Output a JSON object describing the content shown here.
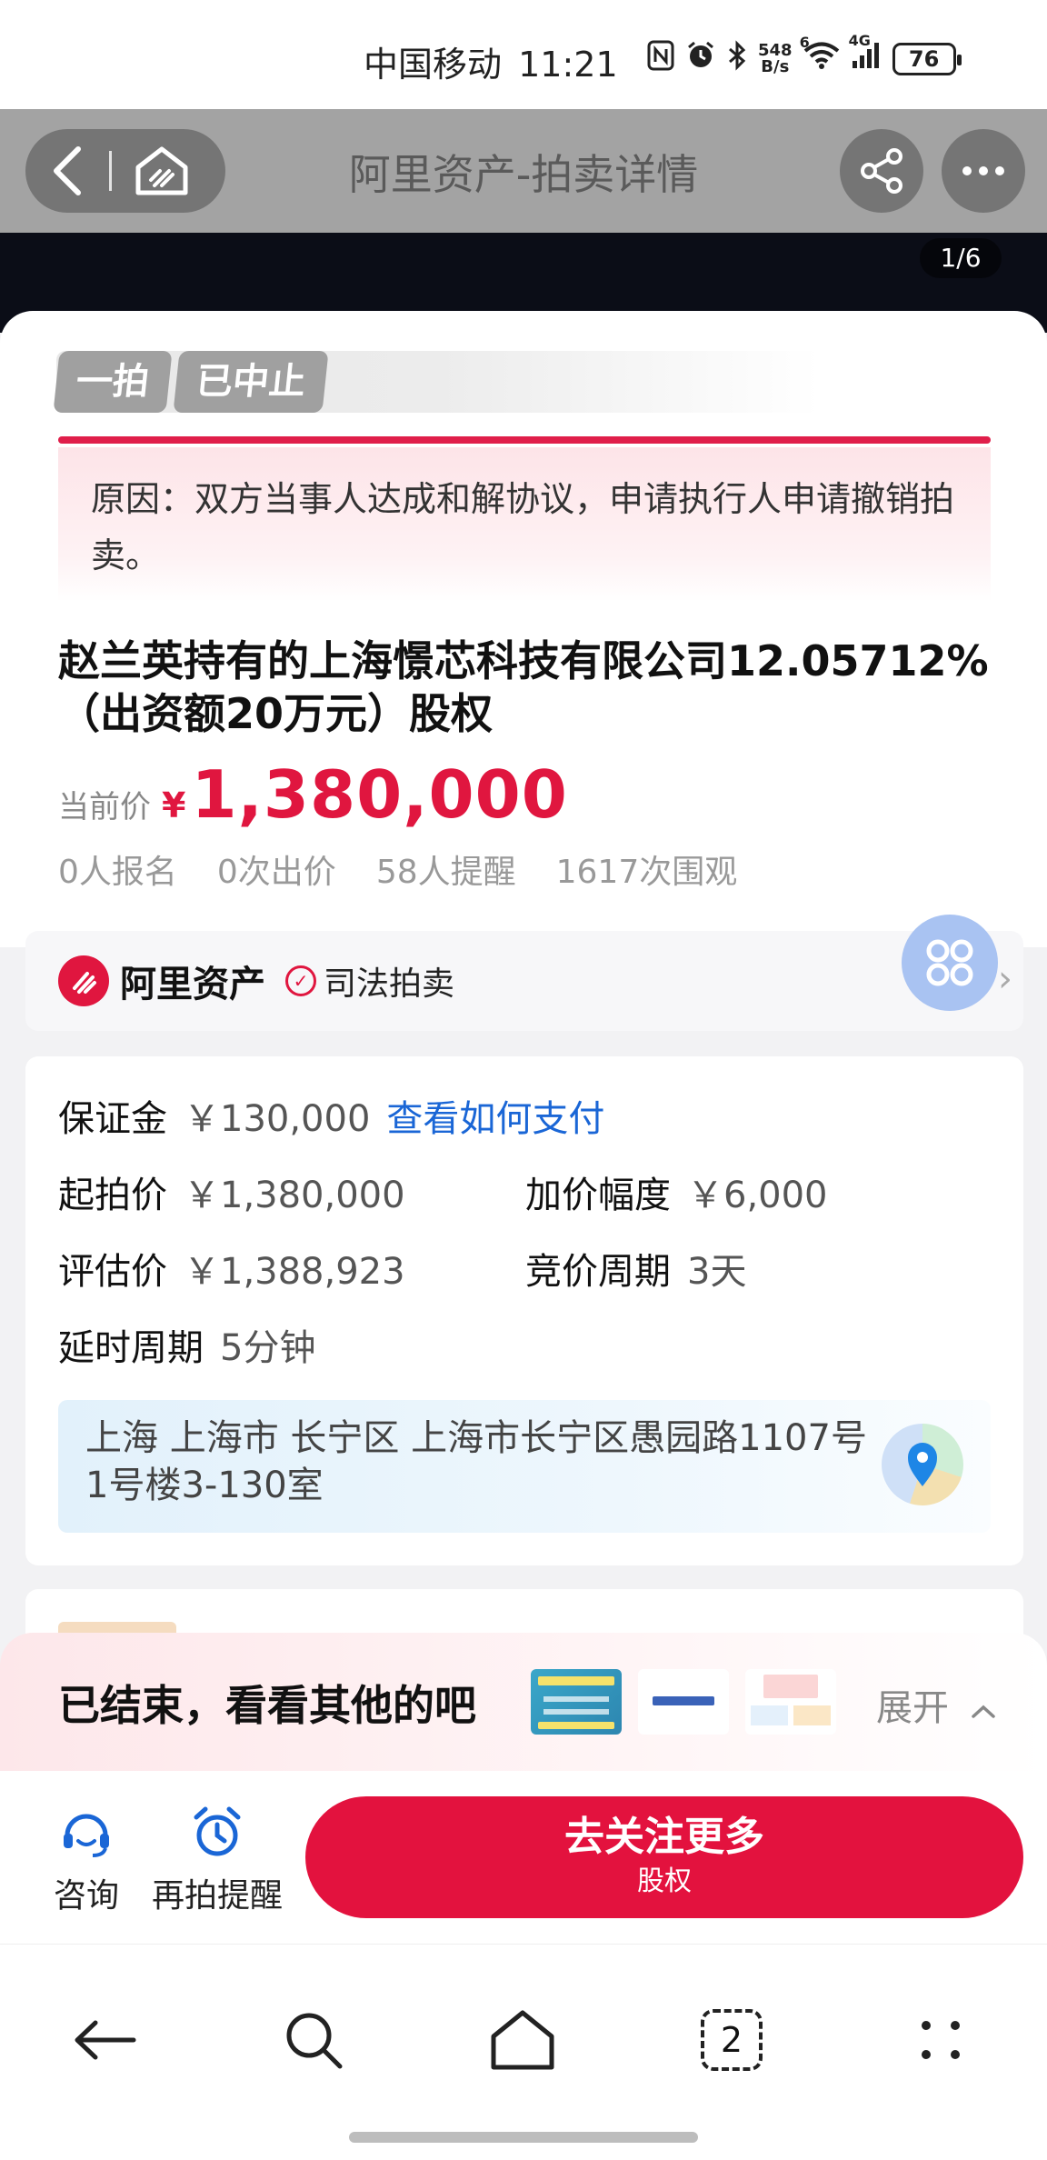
{
  "status_bar": {
    "carrier": "中国移动",
    "time": "11:21",
    "net_speed_value": "548",
    "net_speed_unit": "B/s",
    "signal_6": "6",
    "signal_4g": "4G",
    "battery": "76"
  },
  "nav": {
    "title": "阿里资产-拍卖详情",
    "icons": [
      "back-icon",
      "home-icon",
      "share-icon",
      "more-icon"
    ]
  },
  "gallery": {
    "counter": "1/6"
  },
  "auction": {
    "round_tag": "一拍",
    "status_tag": "已中止",
    "reason": "原因：双方当事人达成和解协议，申请执行人申请撤销拍卖。",
    "title": "赵兰英持有的上海憬芯科技有限公司12.05712%（出资额20万元）股权",
    "price_label": "当前价",
    "currency": "¥",
    "current_price": "1,380,000",
    "stats": {
      "signups": "0人报名",
      "bids": "0次出价",
      "reminders": "58人提醒",
      "views": "1617次围观"
    }
  },
  "platform": {
    "name": "阿里资产",
    "type": "司法拍卖"
  },
  "details": {
    "deposit_label": "保证金",
    "deposit_value": "￥130,000",
    "deposit_link": "查看如何支付",
    "start_price_label": "起拍价",
    "start_price_value": "￥1,380,000",
    "increment_label": "加价幅度",
    "increment_value": "￥6,000",
    "appraisal_label": "评估价",
    "appraisal_value": "￥1,388,923",
    "period_label": "竞价周期",
    "period_value": "3天",
    "delay_label": "延时周期",
    "delay_value": "5分钟",
    "address": "上海 上海市 长宁区 上海市长宁区愚园路1107号1号楼3-130室"
  },
  "ended": {
    "text": "已结束，看看其他的吧",
    "expand_label": "展开"
  },
  "actions": {
    "consult_label": "咨询",
    "reminder_label": "再拍提醒",
    "cta_main": "去关注更多",
    "cta_sub": "股权"
  },
  "system_nav": {
    "tabs_count": "2",
    "icons": [
      "back-arrow-icon",
      "search-icon",
      "home-icon",
      "tabs-icon",
      "menu-dots-icon"
    ]
  },
  "colors": {
    "accent_red": "#e0163f",
    "link_blue": "#1a66d6",
    "nav_gray": "#a3a3a3",
    "tag_gray": "#a0a0a0"
  }
}
